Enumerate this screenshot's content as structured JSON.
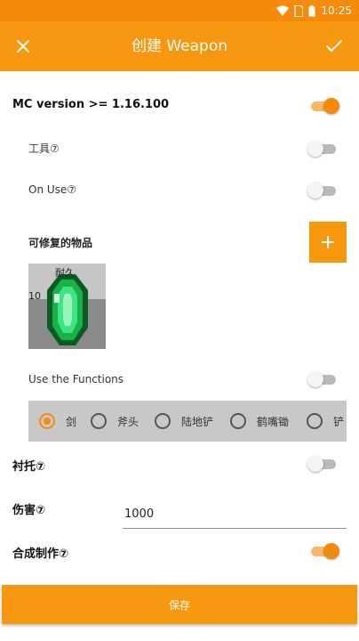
{
  "status_bar": {
    "time": "10:25"
  },
  "app_bar": {
    "title": "创建 Weapon"
  },
  "rows": {
    "mc_version": {
      "label": "MC version >= 1.16.100",
      "on": true
    },
    "tool": {
      "label": "工具⑦",
      "on": false
    },
    "on_use": {
      "label": "On Use⑦",
      "on": false
    },
    "repairable": {
      "label": "可修复的物品"
    },
    "use_functions": {
      "label": "Use the Functions",
      "on": false
    },
    "backing": {
      "label": "衬托⑦",
      "on": false
    },
    "damage": {
      "label": "伤害⑦",
      "value": "1000"
    },
    "crafting": {
      "label": "合成制作⑦",
      "on": true
    }
  },
  "repair_item": {
    "durability_label": "耐久",
    "durability_value": "10"
  },
  "tool_types": [
    {
      "label": "剑",
      "checked": true
    },
    {
      "label": "斧头",
      "checked": false
    },
    {
      "label": "陆地铲",
      "checked": false
    },
    {
      "label": "鹤嘴锄",
      "checked": false
    },
    {
      "label": "铲",
      "checked": false
    }
  ],
  "save_button": {
    "label": "保存"
  },
  "colors": {
    "accent": "#f7960f",
    "status_bar": "#f58a0b"
  }
}
